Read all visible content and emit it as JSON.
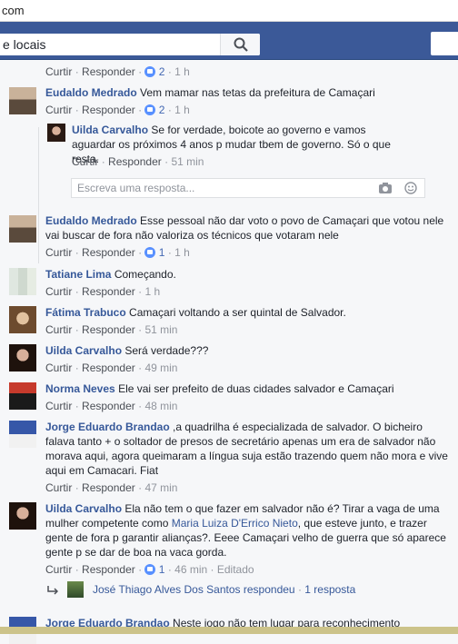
{
  "browser": {
    "url_fragment": "com"
  },
  "topbar": {
    "search_placeholder": "e locais"
  },
  "actions": {
    "like": "Curtir",
    "reply": "Responder",
    "sep": "·",
    "edited": "Editado"
  },
  "comments": [
    {
      "counts": "2",
      "time": "1 h"
    },
    {
      "author": "Eudaldo Medrado",
      "text": "Vem mamar nas tetas da prefeitura de Camaçari",
      "count": "2",
      "time": "1 h",
      "reply": {
        "author": "Uilda Carvalho",
        "text": "Se for verdade, boicote ao governo e vamos aguardar os próximos 4 anos p mudar tbem de governo. Só o que resta.",
        "time": "51 min"
      },
      "reply_placeholder": "Escreva uma resposta..."
    },
    {
      "author": "Eudaldo Medrado",
      "text": "Esse pessoal não dar voto o povo de Camaçari que votou nele vai buscar de fora não valoriza os técnicos que votaram nele",
      "count": "1",
      "time": "1 h"
    },
    {
      "author": "Tatiane Lima",
      "text": "Começando.",
      "time": "1 h"
    },
    {
      "author": "Fátima Trabuco",
      "text": "Camaçari voltando a ser quintal de Salvador.",
      "time": "51 min"
    },
    {
      "author": "Uilda Carvalho",
      "text": "Será verdade???",
      "time": "49 min"
    },
    {
      "author": "Norma Neves",
      "text": "Ele vai ser prefeito de duas cidades salvador e Camaçari",
      "time": "48 min"
    },
    {
      "author": "Jorge Eduardo Brandao",
      "text": ",a quadrilha é especializada de salvador. O bicheiro falava tanto + o soltador de presos de secretário apenas um era de salvador não morava aqui, agora queimaram a língua suja estão trazendo quem não mora e vive aqui em Camacari. Fiat",
      "time": "47 min"
    },
    {
      "author": "Uilda Carvalho",
      "text_before": "Ela não tem o que fazer em salvador não é? Tirar a vaga de uma mulher competente como ",
      "mention": "Maria Luiza D'Errico Nieto",
      "text_after": ", que esteve junto, e trazer gente de fora p garantir alianças?. Eeee Camaçari velho de guerra que só aparece gente p se dar de boa na vaca gorda.",
      "count": "1",
      "time": "46 min",
      "replied": "José Thiago Alves Dos Santos respondeu",
      "replies_count": "1 resposta"
    },
    {
      "author": "Jorge Eduardo Brandao",
      "text": "Neste jogo não tem lugar para reconhecimento"
    }
  ]
}
